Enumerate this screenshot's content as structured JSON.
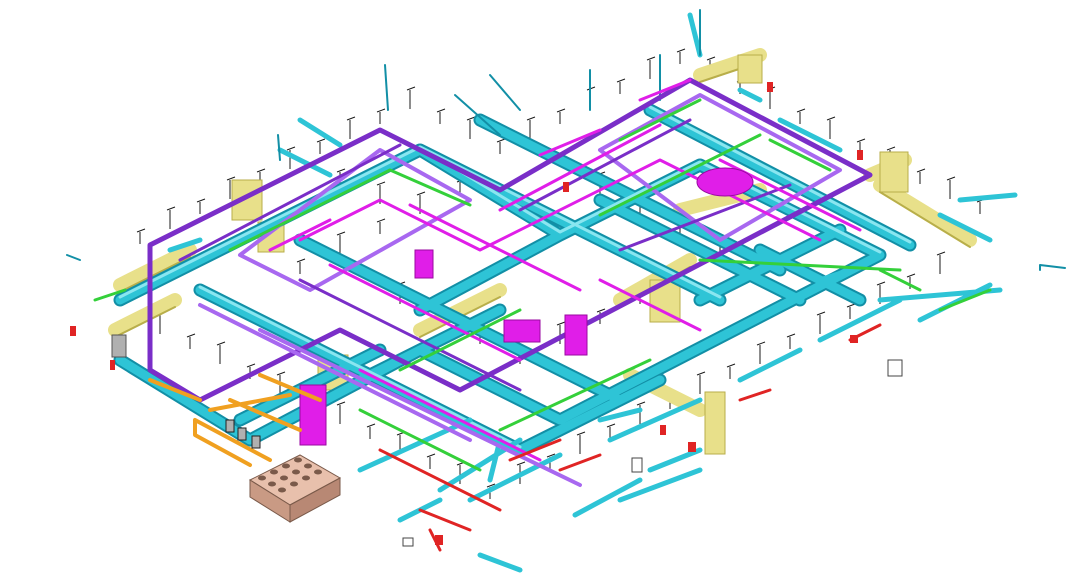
{
  "scene": {
    "kind": "isometric MEP coordination model",
    "background": "#ffffff"
  },
  "colors": {
    "duct_cyan": "#2ec4d6",
    "duct_cyan_dark": "#128fa6",
    "duct_cyan_light": "#8ae6f0",
    "loop_purple": "#7a2ec8",
    "loop_purple_light": "#a868f0",
    "pipe_magenta": "#e01ee8",
    "pipe_green": "#34d03a",
    "duct_yellow": "#e8e08a",
    "duct_yellow_dark": "#b8ae4a",
    "pipe_red": "#e02424",
    "pipe_orange": "#f0a020",
    "hanger_black": "#1a1a1a",
    "equipment_tan": "#d8a890",
    "equipment_grey": "#b0b0b0"
  },
  "systems": [
    {
      "name": "supply-duct",
      "color_ref": "duct_cyan"
    },
    {
      "name": "heating-loop",
      "color_ref": "loop_purple"
    },
    {
      "name": "process-pipe",
      "color_ref": "pipe_magenta"
    },
    {
      "name": "water-pipe",
      "color_ref": "pipe_green"
    },
    {
      "name": "return-duct",
      "color_ref": "duct_yellow"
    },
    {
      "name": "fire-sprinkler",
      "color_ref": "pipe_red"
    },
    {
      "name": "gas-pipe",
      "color_ref": "pipe_orange"
    }
  ],
  "equipment": {
    "chiller_block": {
      "color_ref": "equipment_tan",
      "cells": 12
    }
  }
}
